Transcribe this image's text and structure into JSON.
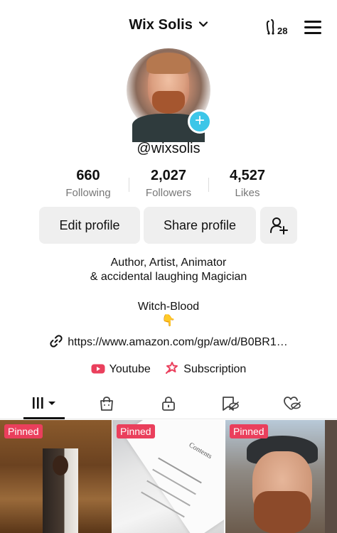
{
  "header": {
    "username": "Wix Solis",
    "friends_count": "28",
    "friends_icon": "friends-footprint-icon",
    "menu_icon": "hamburger-menu-icon"
  },
  "profile": {
    "handle": "@wixsolis",
    "avatar_badge_icon": "plus-icon"
  },
  "stats": [
    {
      "value": "660",
      "label": "Following"
    },
    {
      "value": "2,027",
      "label": "Followers"
    },
    {
      "value": "4,527",
      "label": "Likes"
    }
  ],
  "actions": {
    "edit_label": "Edit profile",
    "share_label": "Share profile",
    "add_friend_icon": "add-friend-icon"
  },
  "bio": {
    "line1": "Author, Artist, Animator",
    "line2": "& accidental laughing Magician",
    "line3": "Witch-Blood",
    "emoji": "👇"
  },
  "link": {
    "url": "https://www.amazon.com/gp/aw/d/B0BR1…"
  },
  "social": [
    {
      "label": "Youtube",
      "icon": "youtube-icon",
      "color": "#ea3f5c"
    },
    {
      "label": "Subscription",
      "icon": "subscription-icon",
      "color": "#ea3f5c"
    }
  ],
  "tabs": [
    {
      "name": "videos",
      "icon": "grid-bars-icon",
      "active": true
    },
    {
      "name": "shop",
      "icon": "shopping-bag-icon"
    },
    {
      "name": "private",
      "icon": "lock-icon"
    },
    {
      "name": "reposts",
      "icon": "hidden-repost-icon"
    },
    {
      "name": "liked",
      "icon": "hidden-heart-icon"
    }
  ],
  "videos": [
    {
      "badge": "Pinned"
    },
    {
      "badge": "Pinned",
      "page_text": "Contents"
    },
    {
      "badge": "Pinned"
    }
  ],
  "colors": {
    "accent_pink": "#ea3f5c",
    "badge_blue": "#3cc6e8",
    "button_gray": "#efefef"
  }
}
